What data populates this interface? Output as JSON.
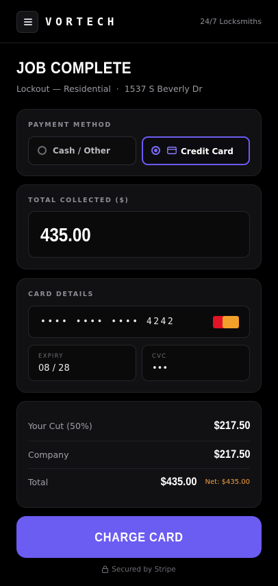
{
  "header": {
    "brand": "VORTECH",
    "tagline": "24/7 Locksmiths",
    "menu_icon": "hamburger-menu-icon"
  },
  "job": {
    "title": "JOB COMPLETE",
    "subtitle": "Lockout — Residential  ·  1537 S Beverly Dr"
  },
  "payment_method": {
    "label": "PAYMENT METHOD",
    "options": [
      {
        "label": "Cash / Other",
        "selected": false
      },
      {
        "label": "Credit Card",
        "selected": true,
        "icon": "credit-card-icon"
      }
    ],
    "accent_color": "#6b5cf2"
  },
  "total_collected": {
    "label": "TOTAL COLLECTED ($)",
    "value": "435.00"
  },
  "card_details": {
    "label": "CARD DETAILS",
    "card_number": "•••• •••• •••• 4242",
    "brand_icon": "mastercard-icon",
    "expiry_label": "EXPIRY",
    "expiry_value": "08 / 28",
    "cvc_label": "CVC",
    "cvc_value": "•••"
  },
  "summary": {
    "rows": [
      {
        "label": "Your Cut (50%)",
        "value": "$217.50"
      },
      {
        "label": "Company",
        "value": "$217.50"
      }
    ],
    "total_label": "Total",
    "total_value": "$435.00",
    "net_text": "Net: $435.00",
    "net_color": "#f0a040"
  },
  "actions": {
    "charge_label": "CHARGE CARD",
    "secured_text": "Secured by Stripe",
    "secured_icon": "lock-icon"
  }
}
